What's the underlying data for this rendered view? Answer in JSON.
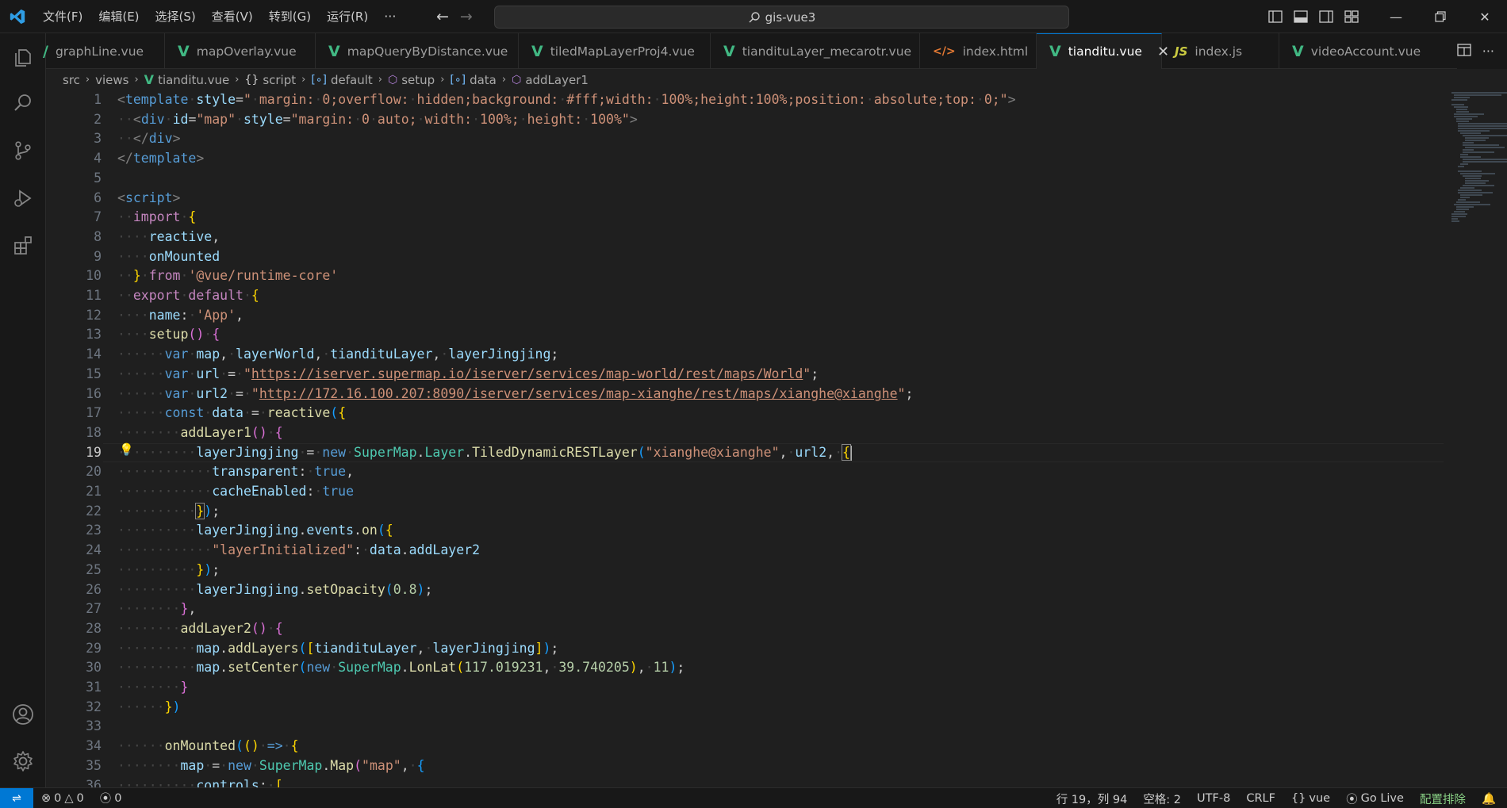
{
  "titlebar": {
    "menus": [
      "文件(F)",
      "编辑(E)",
      "选择(S)",
      "查看(V)",
      "转到(G)",
      "运行(R)"
    ],
    "more": "···",
    "search_text": "gis-vue3"
  },
  "tabs": [
    {
      "label": "graphLine.vue",
      "icon": "vue"
    },
    {
      "label": "mapOverlay.vue",
      "icon": "vue"
    },
    {
      "label": "mapQueryByDistance.vue",
      "icon": "vue"
    },
    {
      "label": "tiledMapLayerProj4.vue",
      "icon": "vue"
    },
    {
      "label": "tiandituLayer_mecarotr.vue",
      "icon": "vue"
    },
    {
      "label": "index.html",
      "icon": "html"
    },
    {
      "label": "tianditu.vue",
      "icon": "vue",
      "active": true
    },
    {
      "label": "index.js",
      "icon": "js"
    },
    {
      "label": "videoAccount.vue",
      "icon": "vue"
    }
  ],
  "breadcrumb": {
    "items": [
      "src",
      "views",
      "tianditu.vue",
      "script",
      "default",
      "setup",
      "data",
      "addLayer1"
    ]
  },
  "editor": {
    "line_numbers": [
      "1",
      "2",
      "3",
      "4",
      "5",
      "6",
      "7",
      "8",
      "9",
      "10",
      "11",
      "12",
      "13",
      "14",
      "15",
      "16",
      "17",
      "18",
      "19",
      "20",
      "21",
      "22",
      "23",
      "24",
      "25",
      "26",
      "27",
      "28",
      "29",
      "30",
      "31",
      "32",
      "33",
      "34",
      "35",
      "36"
    ],
    "active_line": 19
  },
  "statusbar": {
    "errors": "0",
    "warnings": "0",
    "ports": "0",
    "position": "行 19，列 94",
    "spaces": "空格: 2",
    "encoding": "UTF-8",
    "eol": "CRLF",
    "language": "vue",
    "golive": "Go Live",
    "config": "配置排除"
  },
  "colors": {
    "accent": "#0078d4",
    "vue": "#41b883",
    "status_green": "#89d185"
  }
}
